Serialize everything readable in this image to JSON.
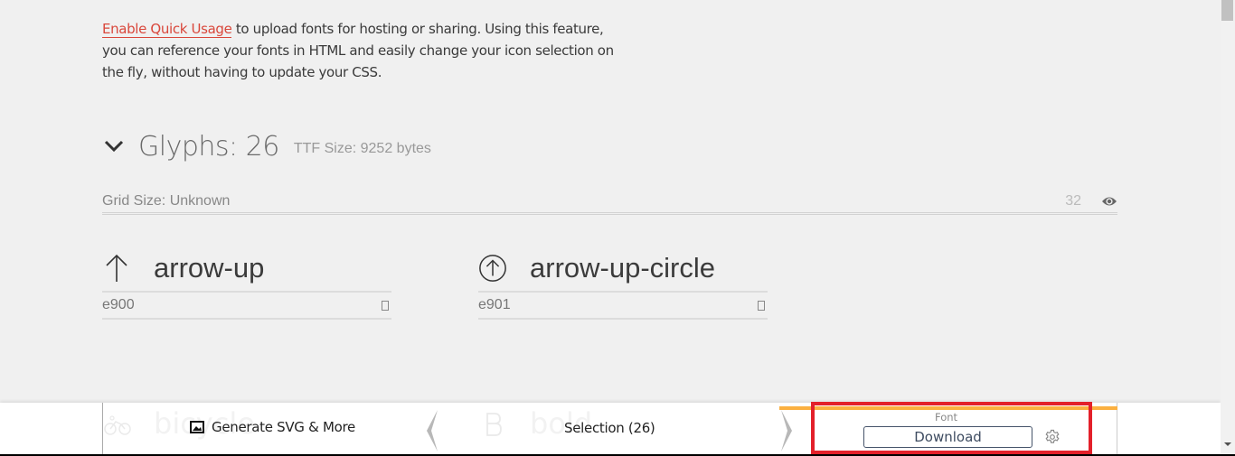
{
  "intro": {
    "link_text": "Enable Quick Usage",
    "text": " to upload fonts for hosting or sharing. Using this feature, you can reference your fonts in HTML and easily change your icon selection on the fly, without having to update your CSS."
  },
  "glyphs": {
    "title": "Glyphs: 26",
    "ttf_size": "TTF Size: 9252 bytes",
    "grid_size_label": "Grid Size: Unknown",
    "grid_value": "32",
    "toggle_icon": "chevron-down-icon",
    "preview_icon": "eye-icon"
  },
  "glyph_items": [
    {
      "name": "arrow-up",
      "code": "e900",
      "icon": "arrow-up-icon"
    },
    {
      "name": "arrow-up-circle",
      "code": "e901",
      "icon": "arrow-up-circle-icon"
    }
  ],
  "ghost_items": [
    {
      "name": "bicycle",
      "icon": "bicycle-icon"
    },
    {
      "name": "bold",
      "icon": "bold-icon"
    }
  ],
  "bottombar": {
    "generate_label": "Generate SVG & More",
    "generate_icon": "image-icon",
    "selection_label": "Selection (26)",
    "font_label": "Font",
    "download_label": "Download",
    "settings_icon": "gear-icon",
    "accent_color": "#fbb040",
    "highlight_color": "#e3202a"
  }
}
